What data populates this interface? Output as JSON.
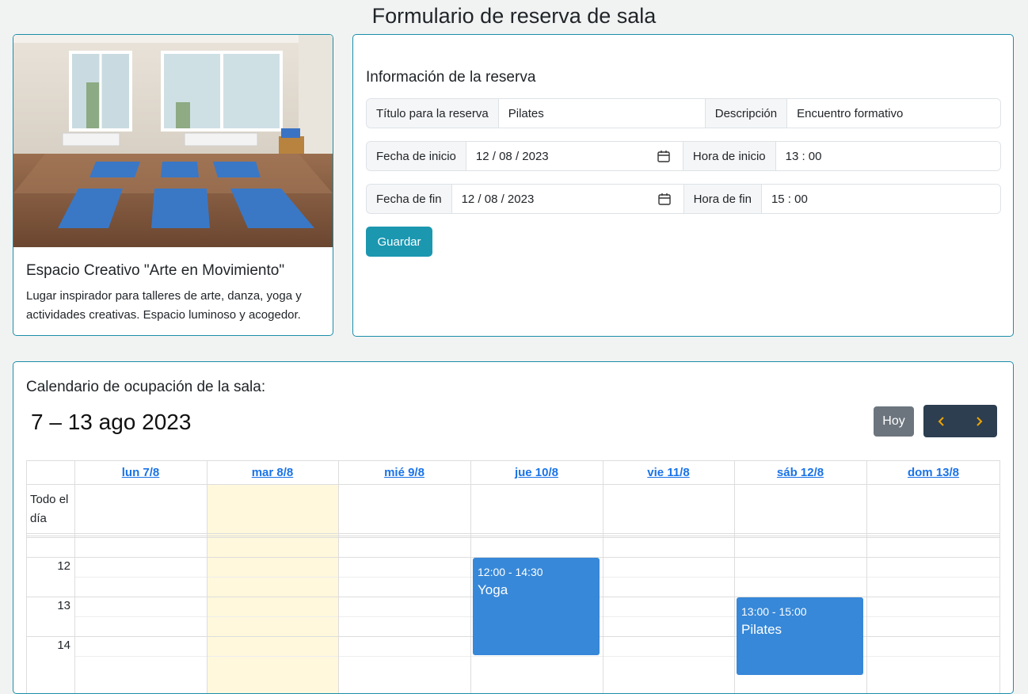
{
  "page": {
    "title": "Formulario de reserva de sala"
  },
  "room": {
    "title": "Espacio Creativo \"Arte en Movimiento\"",
    "description": "Lugar inspirador para talleres de arte, danza, yoga y actividades creativas. Espacio luminoso y acogedor."
  },
  "form": {
    "title": "Información de la reserva",
    "title_label": "Título para la reserva",
    "title_value": "Pilates",
    "description_label": "Descripción",
    "description_value": "Encuentro formativo",
    "start_date_label": "Fecha de inicio",
    "start_date_value": "12 / 08 / 2023",
    "start_time_label": "Hora de inicio",
    "start_time_value": "13 : 00",
    "end_date_label": "Fecha de fin",
    "end_date_value": "12 / 08 / 2023",
    "end_time_label": "Hora de fin",
    "end_time_value": "15 : 00",
    "save_label": "Guardar"
  },
  "calendar": {
    "caption": "Calendario de ocupación de la sala:",
    "range": "7 – 13 ago 2023",
    "today_label": "Hoy",
    "prev_icon": "chevron-left-icon",
    "next_icon": "chevron-right-icon",
    "days": [
      "lun 7/8",
      "mar 8/8",
      "mié 9/8",
      "jue 10/8",
      "vie 11/8",
      "sáb 12/8",
      "dom 13/8"
    ],
    "today_index": 1,
    "allday_label": "Todo el día",
    "hours": [
      "12",
      "13",
      "14"
    ],
    "events": [
      {
        "day_index": 3,
        "start": 12,
        "end": 14.5,
        "time": "12:00 - 14:30",
        "title": "Yoga"
      },
      {
        "day_index": 5,
        "start": 13,
        "end": 15,
        "time": "13:00 - 15:00",
        "title": "Pilates"
      }
    ]
  },
  "colors": {
    "accent": "#1b97b0",
    "event": "#3788d8",
    "today_highlight": "#fff8dc",
    "nav_dark": "#2c3e50",
    "nav_arrow": "#f0a500"
  }
}
